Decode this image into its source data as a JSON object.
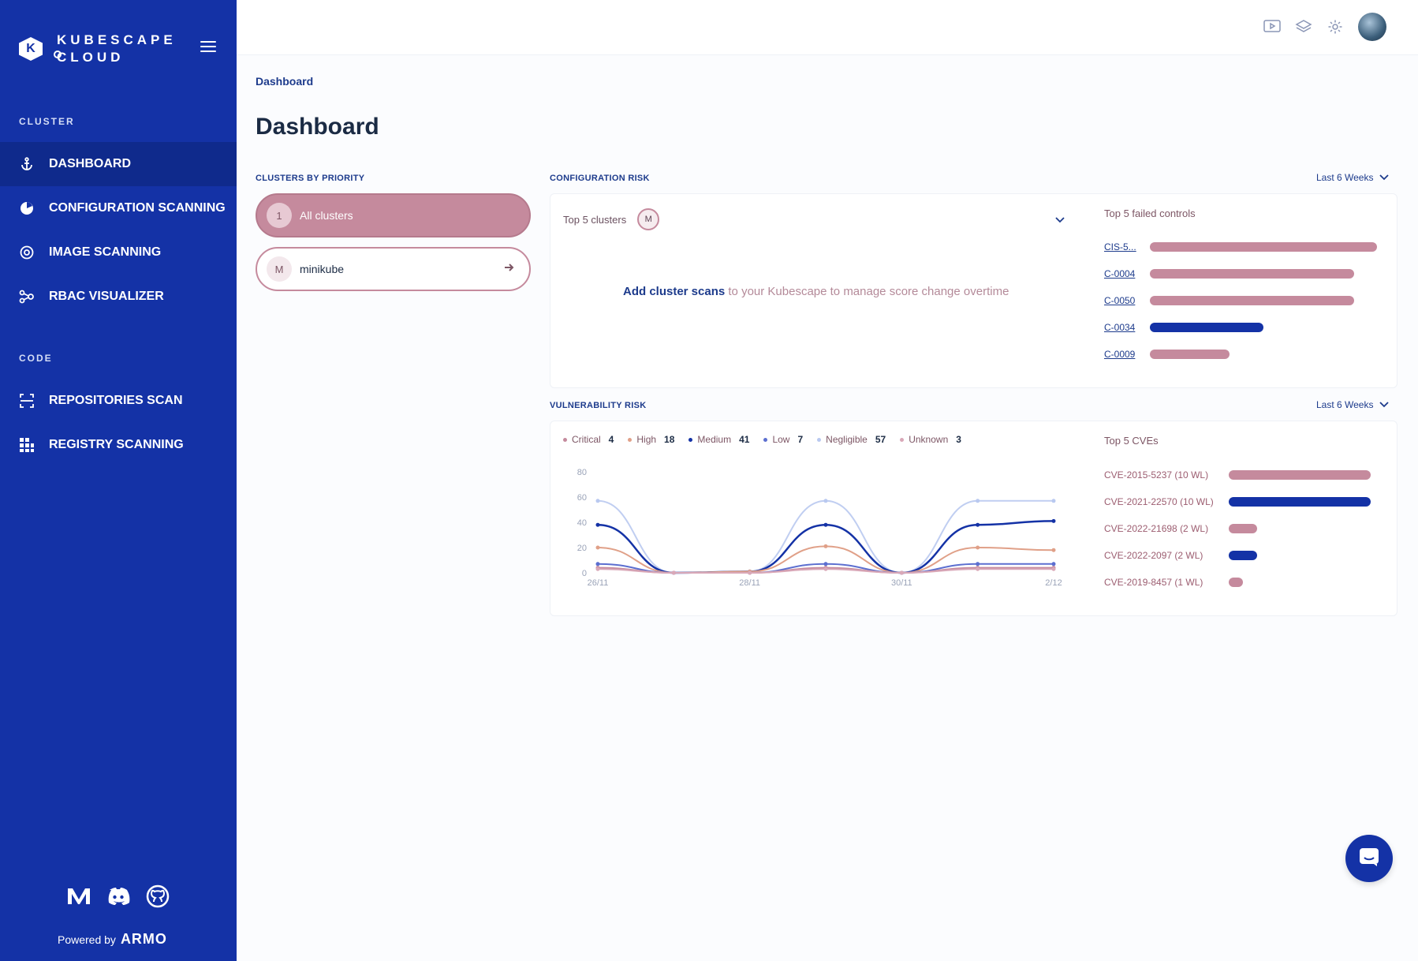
{
  "app": {
    "logo_line1": "KUBESCAPE",
    "logo_line2": "CLOUD",
    "logo_letter": "K"
  },
  "sidebar": {
    "section_cluster": "CLUSTER",
    "section_code": "CODE",
    "items": [
      {
        "label": "DASHBOARD",
        "icon": "anchor-icon",
        "active": true
      },
      {
        "label": "CONFIGURATION SCANNING",
        "icon": "config-scan-icon"
      },
      {
        "label": "IMAGE SCANNING",
        "icon": "image-scan-icon"
      },
      {
        "label": "RBAC VISUALIZER",
        "icon": "rbac-icon"
      },
      {
        "label": "REPOSITORIES SCAN",
        "icon": "repo-scan-icon"
      },
      {
        "label": "REGISTRY SCANNING",
        "icon": "registry-icon"
      }
    ],
    "powered_by": "Powered by",
    "brand": "ARMO",
    "social_icons": [
      "medium-icon",
      "discord-icon",
      "github-icon"
    ]
  },
  "topbar": {
    "icons": [
      "video-icon",
      "layers-icon",
      "gear-icon",
      "avatar"
    ]
  },
  "breadcrumb": "Dashboard",
  "page_title": "Dashboard",
  "clusters_by_priority": {
    "label": "CLUSTERS BY PRIORITY",
    "all": {
      "count": "1",
      "label": "All clusters"
    },
    "items": [
      {
        "initial": "M",
        "name": "minikube"
      }
    ]
  },
  "config_risk": {
    "label": "CONFIGURATION RISK",
    "range": "Last 6 Weeks",
    "top_clusters_label": "Top 5 clusters",
    "cluster_badge": "M",
    "add_link": "Add cluster scans",
    "add_rest": " to your Kubescape to manage score change overtime",
    "failed_title": "Top 5 failed controls",
    "controls": [
      {
        "id": "CIS-5...",
        "value": 1.0,
        "color": "#c58a9d"
      },
      {
        "id": "C-0004",
        "value": 0.9,
        "color": "#c58a9d"
      },
      {
        "id": "C-0050",
        "value": 0.9,
        "color": "#c58a9d"
      },
      {
        "id": "C-0034",
        "value": 0.5,
        "color": "#1432a6"
      },
      {
        "id": "C-0009",
        "value": 0.35,
        "color": "#c58a9d"
      }
    ]
  },
  "vuln_risk": {
    "label": "VULNERABILITY RISK",
    "range": "Last 6 Weeks",
    "legend": [
      {
        "name": "Critical",
        "count": "4",
        "color": "#c58a9d"
      },
      {
        "name": "High",
        "count": "18",
        "color": "#e0a088"
      },
      {
        "name": "Medium",
        "count": "41",
        "color": "#1432a6"
      },
      {
        "name": "Low",
        "count": "7",
        "color": "#5c6fd0"
      },
      {
        "name": "Negligible",
        "count": "57",
        "color": "#b9c9f0"
      },
      {
        "name": "Unknown",
        "count": "3",
        "color": "#d9a8b8"
      }
    ],
    "cve_title": "Top 5 CVEs",
    "cves": [
      {
        "label": "CVE-2015-5237 (10 WL)",
        "value": 10,
        "color": "#c58a9d"
      },
      {
        "label": "CVE-2021-22570 (10 WL)",
        "value": 10,
        "color": "#1432a6"
      },
      {
        "label": "CVE-2022-21698 (2 WL)",
        "value": 2,
        "color": "#c58a9d"
      },
      {
        "label": "CVE-2022-2097 (2 WL)",
        "value": 2,
        "color": "#1432a6"
      },
      {
        "label": "CVE-2019-8457 (1 WL)",
        "value": 1,
        "color": "#c58a9d"
      }
    ]
  },
  "chart_data": {
    "type": "line",
    "x": [
      "26/11",
      "27/11",
      "28/11",
      "29/11",
      "30/11",
      "1/12",
      "2/12"
    ],
    "x_ticks": [
      "26/11",
      "28/11",
      "30/11",
      "2/12"
    ],
    "ylim": [
      0,
      80
    ],
    "y_ticks": [
      0,
      20,
      40,
      60,
      80
    ],
    "grid": false,
    "series": [
      {
        "name": "Negligible",
        "color": "#b9c9f0",
        "values": [
          57,
          0,
          1,
          57,
          0,
          57,
          57
        ]
      },
      {
        "name": "Medium",
        "color": "#1432a6",
        "values": [
          38,
          0,
          1,
          38,
          0,
          38,
          41
        ]
      },
      {
        "name": "High",
        "color": "#e0a088",
        "values": [
          20,
          0,
          1,
          21,
          0,
          20,
          18
        ]
      },
      {
        "name": "Low",
        "color": "#5c6fd0",
        "values": [
          7,
          0,
          0,
          7,
          0,
          7,
          7
        ]
      },
      {
        "name": "Critical",
        "color": "#c58a9d",
        "values": [
          4,
          0,
          0,
          4,
          0,
          4,
          4
        ]
      },
      {
        "name": "Unknown",
        "color": "#d9a8b8",
        "values": [
          3,
          0,
          0,
          3,
          0,
          3,
          3
        ]
      }
    ]
  },
  "chat": {
    "icon": "chat-icon"
  }
}
